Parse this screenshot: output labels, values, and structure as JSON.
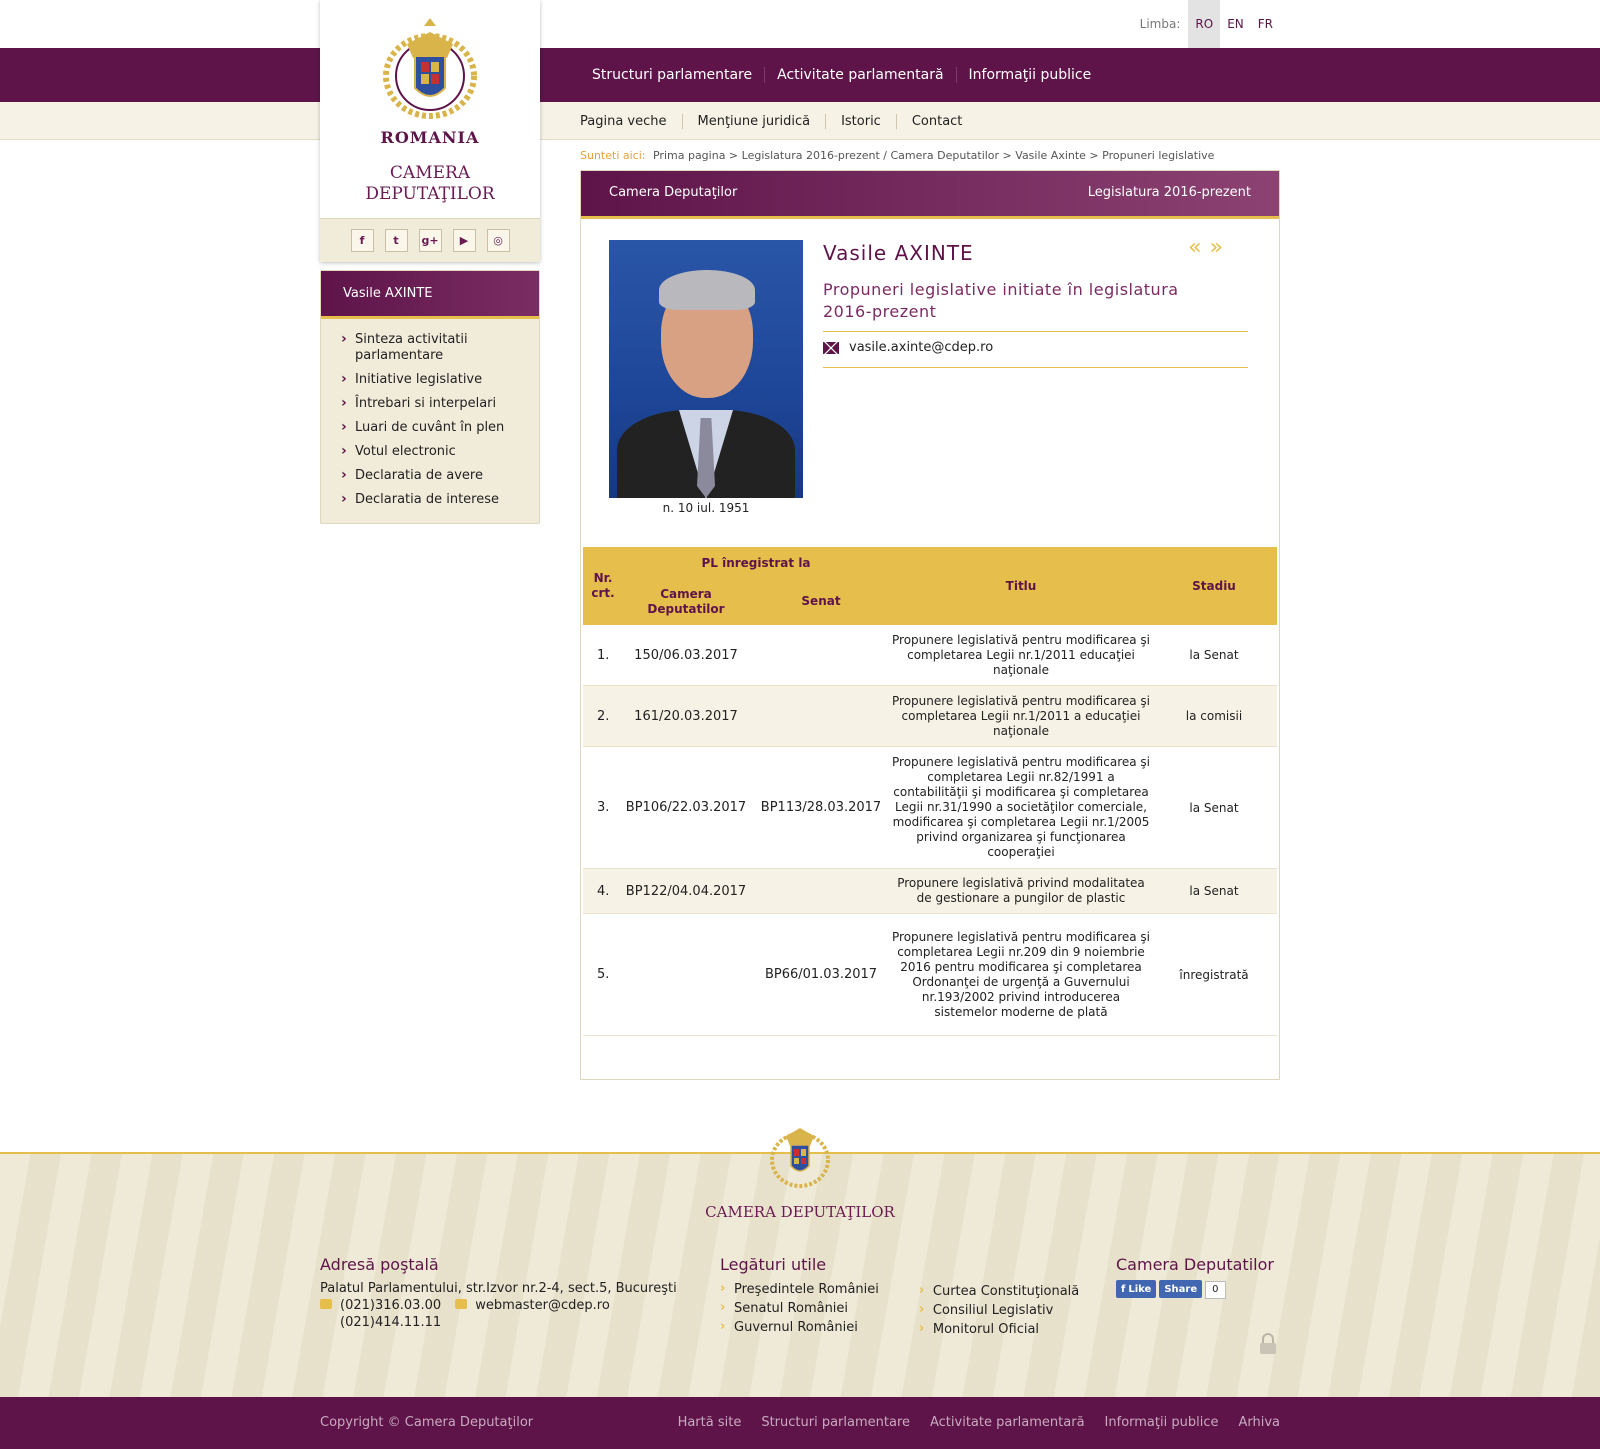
{
  "language": {
    "label": "Limba:",
    "options": [
      "RO",
      "EN",
      "FR"
    ],
    "active": "RO"
  },
  "main_nav": [
    "Structuri parlamentare",
    "Activitate parlamentară",
    "Informaţii publice"
  ],
  "sub_nav": [
    "Pagina veche",
    "Menţiune juridică",
    "Istoric",
    "Contact"
  ],
  "logo": {
    "country": "ROMANIA",
    "institution_line1": "CAMERA",
    "institution_line2": "DEPUTAŢILOR"
  },
  "social_icons": [
    "facebook-icon",
    "twitter-icon",
    "google-plus-icon",
    "youtube-icon",
    "instagram-icon"
  ],
  "sidebar": {
    "title": "Vasile AXINTE",
    "items": [
      "Sinteza activitatii parlamentare",
      "Initiative legislative",
      "Întrebari si interpelari",
      "Luari de cuvânt în plen",
      "Votul electronic",
      "Declaratia de avere",
      "Declaratia de interese"
    ]
  },
  "breadcrumb": {
    "label": "Sunteti aici:",
    "path": "Prima pagina > Legislatura 2016-prezent / Camera Deputatilor > Vasile Axinte > Propuneri legislative"
  },
  "panel": {
    "header_left": "Camera Deputaţilor",
    "header_right": "Legislatura 2016-prezent",
    "name": "Vasile AXINTE",
    "subtitle": "Propuneri legislative initiate în legislatura 2016-prezent",
    "email": "vasile.axinte@cdep.ro",
    "birth": "n. 10 iul. 1951",
    "nav_prev": "«",
    "nav_next": "»"
  },
  "table": {
    "headers": {
      "nr": "Nr. crt.",
      "pl_group": "PL înregistrat la",
      "cd": "Camera Deputatilor",
      "senat": "Senat",
      "titlu": "Titlu",
      "stadiu": "Stadiu"
    },
    "rows": [
      {
        "nr": "1.",
        "cd": "150/06.03.2017",
        "senat": "",
        "titlu": "Propunere legislativă pentru modificarea şi completarea Legii nr.1/2011 educaţiei naţionale",
        "stadiu": "la Senat"
      },
      {
        "nr": "2.",
        "cd": "161/20.03.2017",
        "senat": "",
        "titlu": "Propunere legislativă pentru modificarea şi completarea Legii nr.1/2011 a educaţiei naţionale",
        "stadiu": "la comisii"
      },
      {
        "nr": "3.",
        "cd": "BP106/22.03.2017",
        "senat": "BP113/28.03.2017",
        "titlu": "Propunere legislativă pentru modificarea şi completarea Legii nr.82/1991 a contabilităţii şi modificarea şi completarea Legii nr.31/1990 a societăţilor comerciale, modificarea şi completarea Legii nr.1/2005 privind organizarea şi funcţionarea cooperaţiei",
        "stadiu": "la Senat"
      },
      {
        "nr": "4.",
        "cd": "BP122/04.04.2017",
        "senat": "",
        "titlu": "Propunere legislativă privind modalitatea de gestionare a pungilor de plastic",
        "stadiu": "la Senat"
      },
      {
        "nr": "5.",
        "cd": "",
        "senat": "BP66/01.03.2017",
        "titlu": "Propunere legislativă pentru modificarea şi completarea Legii nr.209 din 9 noiembrie 2016 pentru modificarea şi completarea Ordonanţei de urgenţă a Guvernului nr.193/2002 privind introducerea sistemelor moderne de plată",
        "stadiu": "înregistrată"
      }
    ]
  },
  "footer": {
    "institution": "CAMERA DEPUTAŢILOR",
    "address_title": "Adresă poştală",
    "address": "Palatul Parlamentului, str.Izvor nr.2-4, sect.5, Bucureşti",
    "phone1": "(021)316.03.00",
    "phone2": "(021)414.11.11",
    "webmaster": "webmaster@cdep.ro",
    "links_title": "Legături utile",
    "links_col1": [
      "Preşedintele României",
      "Senatul României",
      "Guvernul României"
    ],
    "links_col2": [
      "Curtea Constituţională",
      "Consiliul Legislativ",
      "Monitorul Oficial"
    ],
    "social_title": "Camera Deputatilor",
    "fb_like": "Like",
    "fb_share": "Share",
    "fb_count": "0",
    "copyright": "Copyright © Camera Deputaţilor",
    "bottom_links": [
      "Hartă site",
      "Structuri parlamentare",
      "Activitate parlamentară",
      "Informaţii publice",
      "Arhiva"
    ]
  },
  "colors": {
    "brand_purple": "#5e1449",
    "accent_gold": "#e6be4c",
    "cream": "#f1ebda"
  }
}
